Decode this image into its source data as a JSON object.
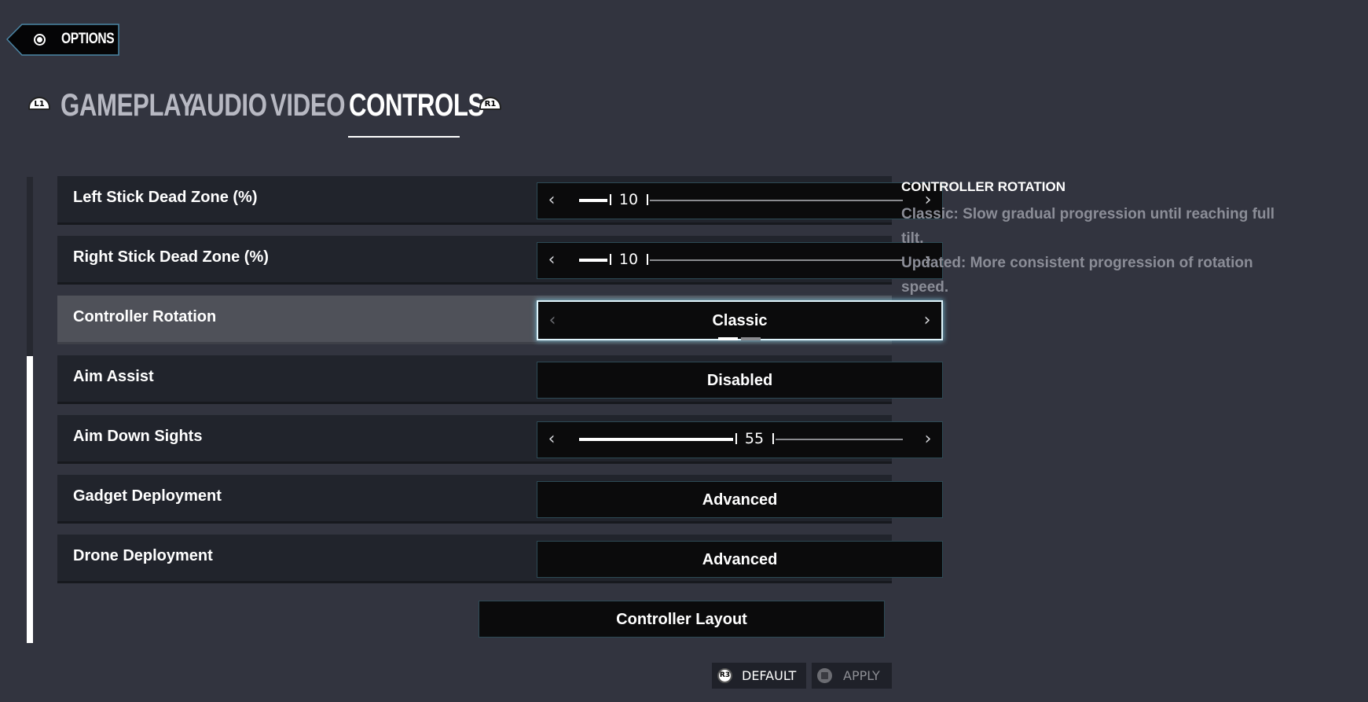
{
  "header": {
    "back_label": "OPTIONS",
    "back_icon": "radio-circle-icon"
  },
  "tabs": {
    "left_shoulder": "L1",
    "right_shoulder": "R1",
    "items": [
      {
        "label": "GAMEPLAY",
        "active": false
      },
      {
        "label": "AUDIO",
        "active": false
      },
      {
        "label": "VIDEO",
        "active": false
      },
      {
        "label": "CONTROLS",
        "active": true
      }
    ]
  },
  "scrollbar": {
    "position_fraction": 0.38
  },
  "settings": [
    {
      "label": "Left Stick Dead Zone (%)",
      "type": "slider",
      "value": 10,
      "min": 0,
      "max": 100
    },
    {
      "label": "Right Stick Dead Zone (%)",
      "type": "slider",
      "value": 10,
      "min": 0,
      "max": 100
    },
    {
      "label": "Controller Rotation",
      "type": "selector",
      "value": "Classic",
      "option_index": 1,
      "option_count": 2,
      "focused": true
    },
    {
      "label": "Aim Assist",
      "type": "value",
      "value": "Disabled"
    },
    {
      "label": "Aim Down Sights",
      "type": "slider",
      "value": 55,
      "min": 0,
      "max": 100
    },
    {
      "label": "Gadget Deployment",
      "type": "value",
      "value": "Advanced"
    },
    {
      "label": "Drone Deployment",
      "type": "value",
      "value": "Advanced"
    }
  ],
  "controller_layout_label": "Controller Layout",
  "info_panel": {
    "title": "CONTROLLER ROTATION",
    "lines": [
      "Classic: Slow gradual progression until reaching full tilt.",
      "Updated: More consistent progression of rotation speed."
    ]
  },
  "footer": {
    "default_label": "DEFAULT",
    "default_icon_text": "R3",
    "apply_label": "APPLY"
  },
  "colors": {
    "background": "#32343f",
    "row": "#21242c",
    "row_focused": "#4f5159",
    "control_border": "#2d4a55",
    "focus_glow": "#dff4fb",
    "inactive_tab": "#b7b8c2",
    "description_text": "#8b8d97"
  }
}
